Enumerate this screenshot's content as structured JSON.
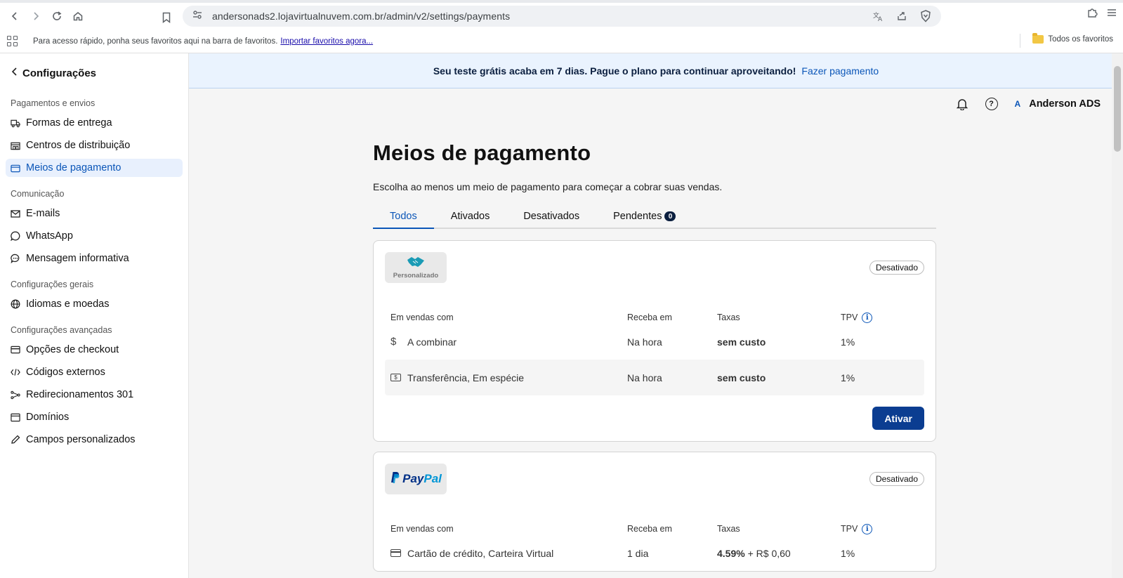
{
  "browser": {
    "url": "andersonads2.lojavirtualnuvem.com.br/admin/v2/settings/payments",
    "bookmarks_prompt": "Para acesso rápido, ponha seus favoritos aqui na barra de favoritos.",
    "bookmarks_import": "Importar favoritos agora...",
    "all_bookmarks": "Todos os favoritos"
  },
  "sidebar": {
    "back_label": "Configurações",
    "groups": [
      {
        "title": "Pagamentos e envios",
        "items": [
          "Formas de entrega",
          "Centros de distribuição",
          "Meios de pagamento"
        ]
      },
      {
        "title": "Comunicação",
        "items": [
          "E-mails",
          "WhatsApp",
          "Mensagem informativa"
        ]
      },
      {
        "title": "Configurações gerais",
        "items": [
          "Idiomas e moedas"
        ]
      },
      {
        "title": "Configurações avançadas",
        "items": [
          "Opções de checkout",
          "Códigos externos",
          "Redirecionamentos 301",
          "Domínios",
          "Campos personalizados"
        ]
      }
    ]
  },
  "banner": {
    "text": "Seu teste grátis acaba em 7 dias. Pague o plano para continuar aproveitando!",
    "link": "Fazer pagamento"
  },
  "topbar": {
    "user_initial": "A",
    "user_name": "Anderson ADS"
  },
  "page": {
    "title": "Meios de pagamento",
    "subtitle": "Escolha ao menos um meio de pagamento para começar a cobrar suas vendas.",
    "tabs": [
      "Todos",
      "Ativados",
      "Desativados",
      "Pendentes"
    ],
    "pending_count": "0"
  },
  "table_headers": {
    "sales": "Em vendas com",
    "receive": "Receba em",
    "fees": "Taxas",
    "tpv": "TPV"
  },
  "cards": [
    {
      "logo_label": "Personalizado",
      "status": "Desativado",
      "rows": [
        {
          "method": "A combinar",
          "receive": "Na hora",
          "fee": "sem custo",
          "tpv": "1%"
        },
        {
          "method": "Transferência, Em espécie",
          "receive": "Na hora",
          "fee": "sem custo",
          "tpv": "1%"
        }
      ],
      "action": "Ativar"
    },
    {
      "logo_text_a": "Pay",
      "logo_text_b": "Pal",
      "status": "Desativado",
      "rows": [
        {
          "method": "Cartão de crédito, Carteira Virtual",
          "receive": "1 dia",
          "fee_bold": "4.59%",
          "fee_rest": " + R$ 0,60",
          "tpv": "1%"
        }
      ]
    }
  ],
  "colors": {
    "accent": "#0b56b8",
    "primary_button": "#0b3d91",
    "banner_bg": "#eaf3fe"
  }
}
